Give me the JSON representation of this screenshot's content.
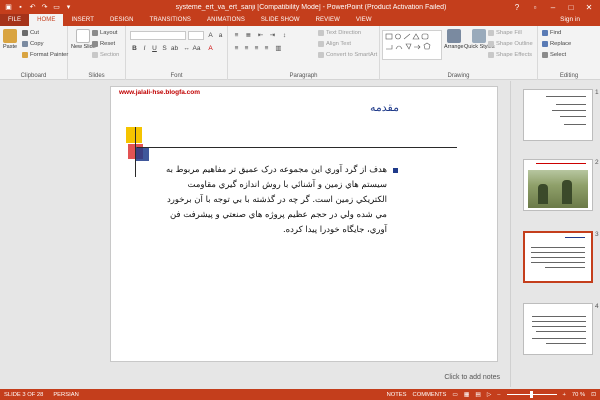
{
  "window": {
    "title": "systeme_ert_va_ert_sanji [Compatibility Mode] - PowerPoint (Product Activation Failed)"
  },
  "tabs": [
    {
      "label": "FILE"
    },
    {
      "label": "HOME"
    },
    {
      "label": "INSERT"
    },
    {
      "label": "DESIGN"
    },
    {
      "label": "TRANSITIONS"
    },
    {
      "label": "ANIMATIONS"
    },
    {
      "label": "SLIDE SHOW"
    },
    {
      "label": "REVIEW"
    },
    {
      "label": "VIEW"
    }
  ],
  "signin": "Sign in",
  "ribbon": {
    "clipboard": {
      "label": "Clipboard",
      "paste": "Paste",
      "cut": "Cut",
      "copy": "Copy",
      "format_painter": "Format Painter"
    },
    "slides": {
      "label": "Slides",
      "new_slide": "New Slide",
      "layout": "Layout",
      "reset": "Reset",
      "section": "Section"
    },
    "font": {
      "label": "Font",
      "font_name": "",
      "font_size": ""
    },
    "paragraph": {
      "label": "Paragraph",
      "text_direction": "Text Direction",
      "align_text": "Align Text",
      "convert_smartart": "Convert to SmartArt"
    },
    "drawing": {
      "label": "Drawing",
      "arrange": "Arrange",
      "quick_styles": "Quick Styles",
      "shape_fill": "Shape Fill",
      "shape_outline": "Shape Outline",
      "shape_effects": "Shape Effects"
    },
    "editing": {
      "label": "Editing",
      "find": "Find",
      "replace": "Replace",
      "select": "Select"
    }
  },
  "slide": {
    "url": "www.jalali-hse.blogfa.com",
    "title": "مقدمه",
    "body": "هدف از گرد آوري اين مجموعه درک عميق تر مفاهيم مربوط به سيستم هاي زمين و آشنائي با روش اندازه گيري مقاومت الکتريکي زمين است. گر چه در گذشته با بي توجه با آن برخورد مي شده ولي در حجم عظيم پروژه هاي صنعتي و پيشرفت فن آوري، جايگاه خودرا پيدا کرده."
  },
  "thumbnails": [
    {
      "num": "1"
    },
    {
      "num": "2"
    },
    {
      "num": "3"
    },
    {
      "num": "4"
    }
  ],
  "notes_placeholder": "Click to add notes",
  "status": {
    "slide_info": "SLIDE 3 OF 28",
    "language": "PERSIAN",
    "notes": "NOTES",
    "comments": "COMMENTS",
    "zoom": "70 %"
  },
  "colors": {
    "accent": "#c43e1c",
    "title_blue": "#1f3a8a",
    "url_red": "#c00000"
  }
}
